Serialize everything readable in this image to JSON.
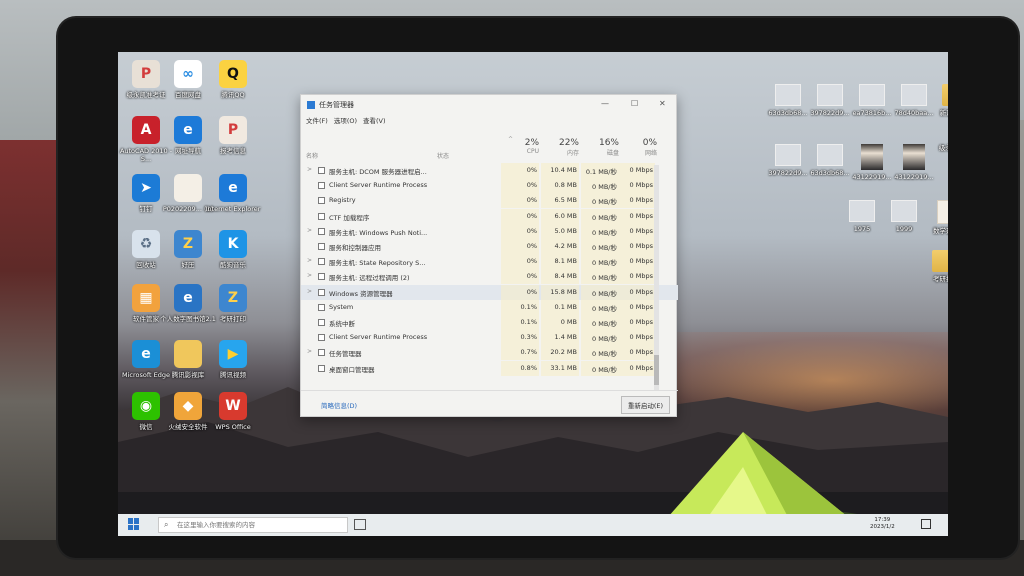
{
  "desktop": {
    "left_icons": [
      {
        "label": "级永凯准考证",
        "glyph": "P",
        "color": "#e8e0d6",
        "glyph_color": "#d23c3c",
        "icon": "pdf-icon"
      },
      {
        "label": "百度网盘",
        "glyph": "∞",
        "color": "#ffffff",
        "glyph_color": "#2a8de2",
        "icon": "baidu-netdisk-icon"
      },
      {
        "label": "腾讯QQ",
        "glyph": "Q",
        "color": "#fbd241",
        "glyph_color": "#111111",
        "icon": "qq-icon"
      },
      {
        "label": "AutoCAD 2010 - S...",
        "glyph": "A",
        "color": "#c8212b",
        "glyph_color": "#ffffff",
        "icon": "autocad-icon"
      },
      {
        "label": "网址导航",
        "glyph": "e",
        "color": "#1d7ad8",
        "glyph_color": "#ffffff",
        "icon": "ie-icon"
      },
      {
        "label": "报考信息",
        "glyph": "P",
        "color": "#f1e9e0",
        "glyph_color": "#d23c3c",
        "icon": "pdf-icon"
      },
      {
        "label": "钉钉",
        "glyph": "➤",
        "color": "#1c7bd6",
        "glyph_color": "#ffffff",
        "icon": "dingtalk-icon"
      },
      {
        "label": "P0202209... (1)",
        "glyph": "",
        "color": "#f4efe6",
        "glyph_color": "#999999",
        "icon": "file-icon"
      },
      {
        "label": "Internet Explorer",
        "glyph": "e",
        "color": "#1d7ad8",
        "glyph_color": "#ffffff",
        "icon": "ie-icon"
      },
      {
        "label": "回收站",
        "glyph": "♻",
        "color": "#d8e2ec",
        "glyph_color": "#5b6f86",
        "icon": "recycle-bin-icon"
      },
      {
        "label": "好压",
        "glyph": "Z",
        "color": "#3d86cf",
        "glyph_color": "#ffd04a",
        "icon": "haozip-icon"
      },
      {
        "label": "酷狗音乐",
        "glyph": "K",
        "color": "#1e94e6",
        "glyph_color": "#ffffff",
        "icon": "kugou-icon"
      },
      {
        "label": "软件管家",
        "glyph": "▦",
        "color": "#f2a23d",
        "glyph_color": "#ffffff",
        "icon": "software-manager-icon"
      },
      {
        "label": "个人数字图书馆2.1",
        "glyph": "e",
        "color": "#2a74c4",
        "glyph_color": "#ffffff",
        "icon": "digital-library-icon"
      },
      {
        "label": "考研打印",
        "glyph": "Z",
        "color": "#3d86cf",
        "glyph_color": "#ffd04a",
        "icon": "archive-icon"
      },
      {
        "label": "Microsoft Edge",
        "glyph": "e",
        "color": "#1b8fd6",
        "glyph_color": "#ffffff",
        "icon": "edge-icon"
      },
      {
        "label": "腾讯影视库",
        "glyph": "",
        "color": "#f0c75c",
        "glyph_color": "#ffffff",
        "icon": "folder-icon"
      },
      {
        "label": "腾讯视频",
        "glyph": "▶",
        "color": "#27a5ee",
        "glyph_color": "#ffcf2f",
        "icon": "tencent-video-icon"
      },
      {
        "label": "微信",
        "glyph": "◉",
        "color": "#2dc100",
        "glyph_color": "#ffffff",
        "icon": "wechat-icon"
      },
      {
        "label": "火绒安全软件",
        "glyph": "◆",
        "color": "#f0a53a",
        "glyph_color": "#ffffff",
        "icon": "huorong-icon"
      },
      {
        "label": "WPS Office",
        "glyph": "W",
        "color": "#d83a2e",
        "glyph_color": "#ffffff",
        "icon": "wps-icon"
      }
    ],
    "right_icons_row1": [
      "63d3db68...",
      "397822d9...",
      "ea73816b...",
      "78d40baa...",
      "新建文件夹"
    ],
    "right_icons_row2": [
      "397822d9...",
      "63d3db68...",
      "43122919...",
      "43122919...",
      "级永凯 发调"
    ],
    "right_icons_row3": [
      "1975",
      "1999",
      "数学建会"
    ],
    "right_icons_row4": [
      "考研打印"
    ]
  },
  "task_manager": {
    "title": "任务管理器",
    "menu": [
      "文件(F)",
      "选项(O)",
      "查看(V)"
    ],
    "window_controls": {
      "minimize": "—",
      "maximize": "☐",
      "close": "✕"
    },
    "columns": {
      "name": "名称",
      "status": "状态",
      "cpu": {
        "pct": "2%",
        "label": "CPU"
      },
      "memory": {
        "pct": "22%",
        "label": "内存"
      },
      "disk": {
        "pct": "16%",
        "label": "磁盘"
      },
      "network": {
        "pct": "0%",
        "label": "网络"
      }
    },
    "rows": [
      {
        "name": "服务主机: DCOM 服务器进程启...",
        "cpu": "0%",
        "mem": "10.4 MB",
        "disk": "0.1 MB/秒",
        "net": "0 Mbps",
        "expand": true
      },
      {
        "name": "Client Server Runtime Process",
        "cpu": "0%",
        "mem": "0.8 MB",
        "disk": "0 MB/秒",
        "net": "0 Mbps",
        "expand": false
      },
      {
        "name": "Registry",
        "cpu": "0%",
        "mem": "6.5 MB",
        "disk": "0 MB/秒",
        "net": "0 Mbps",
        "expand": false
      },
      {
        "name": "CTF 加载程序",
        "cpu": "0%",
        "mem": "6.0 MB",
        "disk": "0 MB/秒",
        "net": "0 Mbps",
        "expand": false
      },
      {
        "name": "服务主机: Windows Push Noti...",
        "cpu": "0%",
        "mem": "5.0 MB",
        "disk": "0 MB/秒",
        "net": "0 Mbps",
        "expand": true
      },
      {
        "name": "服务和控制器应用",
        "cpu": "0%",
        "mem": "4.2 MB",
        "disk": "0 MB/秒",
        "net": "0 Mbps",
        "expand": false
      },
      {
        "name": "服务主机: State Repository S...",
        "cpu": "0%",
        "mem": "8.1 MB",
        "disk": "0 MB/秒",
        "net": "0 Mbps",
        "expand": true
      },
      {
        "name": "服务主机: 远程过程调用 (2)",
        "cpu": "0%",
        "mem": "8.4 MB",
        "disk": "0 MB/秒",
        "net": "0 Mbps",
        "expand": true
      },
      {
        "name": "Windows 资源管理器",
        "cpu": "0%",
        "mem": "15.8 MB",
        "disk": "0 MB/秒",
        "net": "0 Mbps",
        "expand": true
      },
      {
        "name": "System",
        "cpu": "0.1%",
        "mem": "0.1 MB",
        "disk": "0 MB/秒",
        "net": "0 Mbps",
        "expand": false
      },
      {
        "name": "系统中断",
        "cpu": "0.1%",
        "mem": "0 MB",
        "disk": "0 MB/秒",
        "net": "0 Mbps",
        "expand": false
      },
      {
        "name": "Client Server Runtime Process",
        "cpu": "0.3%",
        "mem": "1.4 MB",
        "disk": "0 MB/秒",
        "net": "0 Mbps",
        "expand": false
      },
      {
        "name": "任务管理器",
        "cpu": "0.7%",
        "mem": "20.2 MB",
        "disk": "0 MB/秒",
        "net": "0 Mbps",
        "expand": true
      },
      {
        "name": "桌面窗口管理器",
        "cpu": "0.8%",
        "mem": "33.1 MB",
        "disk": "0 MB/秒",
        "net": "0 Mbps",
        "expand": false
      }
    ],
    "footer": {
      "fewer_details": "简略信息(D)",
      "restart": "重新启动(E)"
    }
  },
  "taskbar": {
    "search_placeholder": "在这里输入你要搜索的内容",
    "time": "17:39",
    "date": "2023/1/2"
  }
}
